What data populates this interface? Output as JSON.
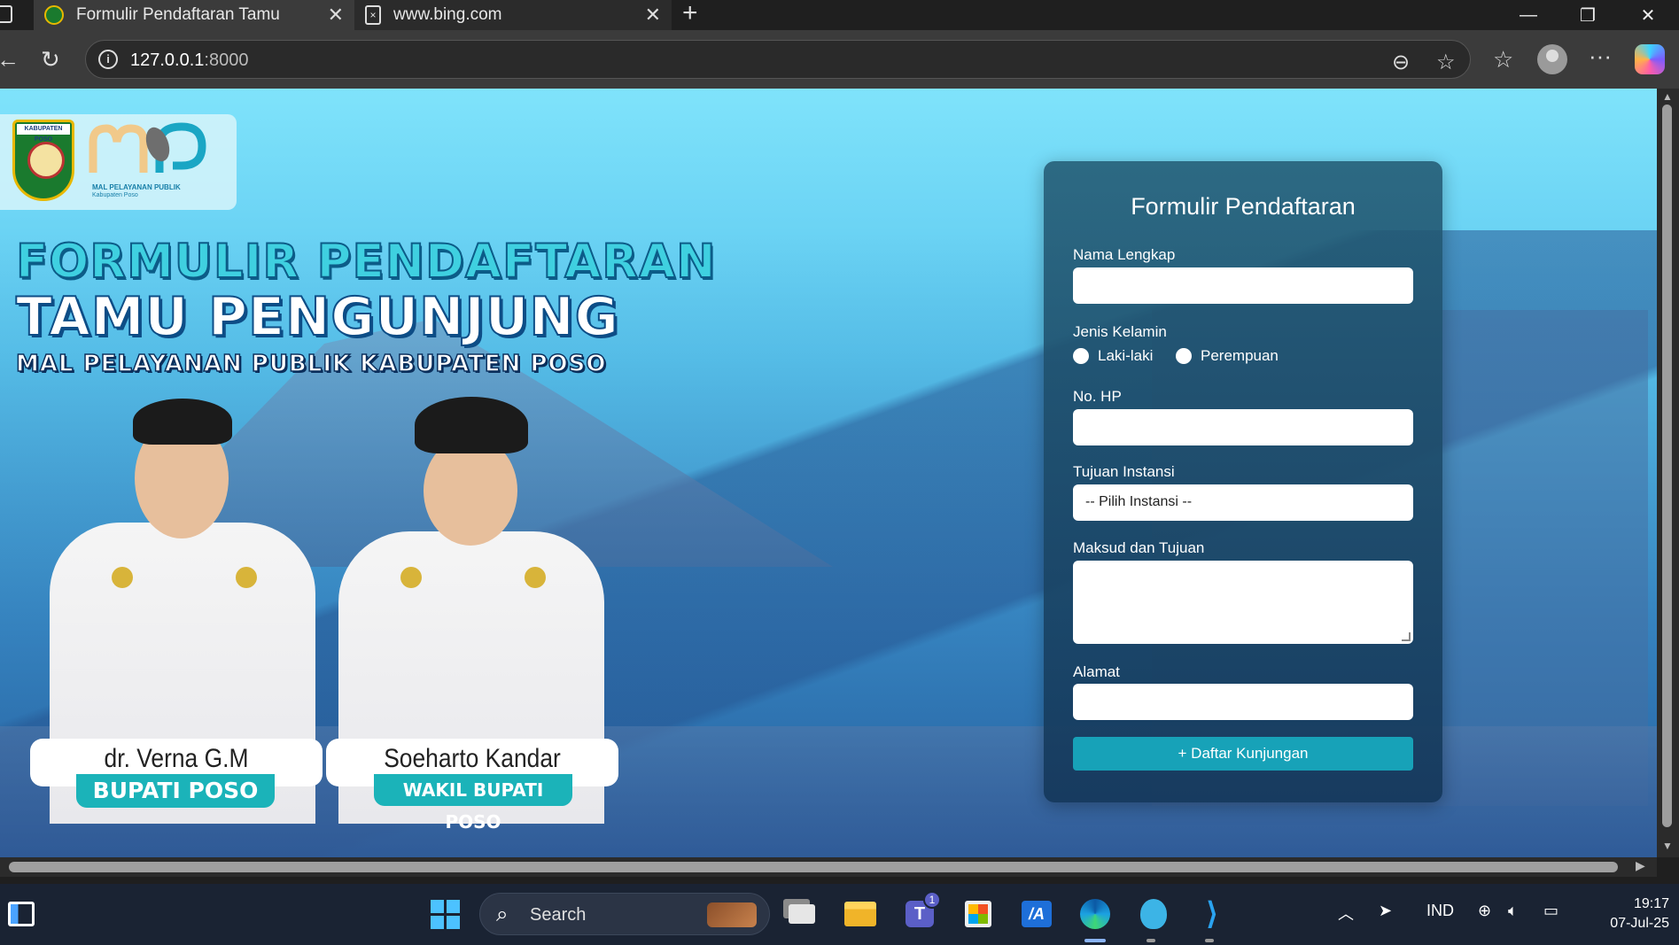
{
  "browser": {
    "tabs": [
      {
        "title": "Formulir Pendaftaran Tamu",
        "active": true
      },
      {
        "title": "www.bing.com",
        "active": false
      }
    ],
    "url_host": "127.0.0.1",
    "url_port": ":8000"
  },
  "page": {
    "logo": {
      "seal_text": "KABUPATEN POSO",
      "mpp_line1": "MAL PELAYANAN PUBLIK",
      "mpp_line2": "Kabupaten Poso"
    },
    "hero": {
      "line1": "FORMULIR PENDAFTARAN",
      "line2": "TAMU PENGUNJUNG",
      "line3": "MAL PELAYANAN PUBLIK KABUPATEN POSO"
    },
    "officials": [
      {
        "name": "dr. Verna G.M Ingkiriwang",
        "role": "BUPATI POSO"
      },
      {
        "name": "Soeharto Kandar",
        "role": "WAKIL BUPATI POSO"
      }
    ],
    "form": {
      "title": "Formulir Pendaftaran",
      "name_label": "Nama Lengkap",
      "name_value": "",
      "gender_label": "Jenis Kelamin",
      "gender_options": [
        "Laki-laki",
        "Perempuan"
      ],
      "phone_label": "No. HP",
      "phone_value": "",
      "agency_label": "Tujuan Instansi",
      "agency_selected": "-- Pilih Instansi --",
      "purpose_label": "Maksud dan Tujuan",
      "purpose_value": "",
      "address_label": "Alamat",
      "address_value": "",
      "submit_label": "+ Daftar Kunjungan"
    }
  },
  "taskbar": {
    "search_label": "Search",
    "teams_badge": "1",
    "language": "IND",
    "time": "19:17",
    "date": "07-Jul-25"
  }
}
